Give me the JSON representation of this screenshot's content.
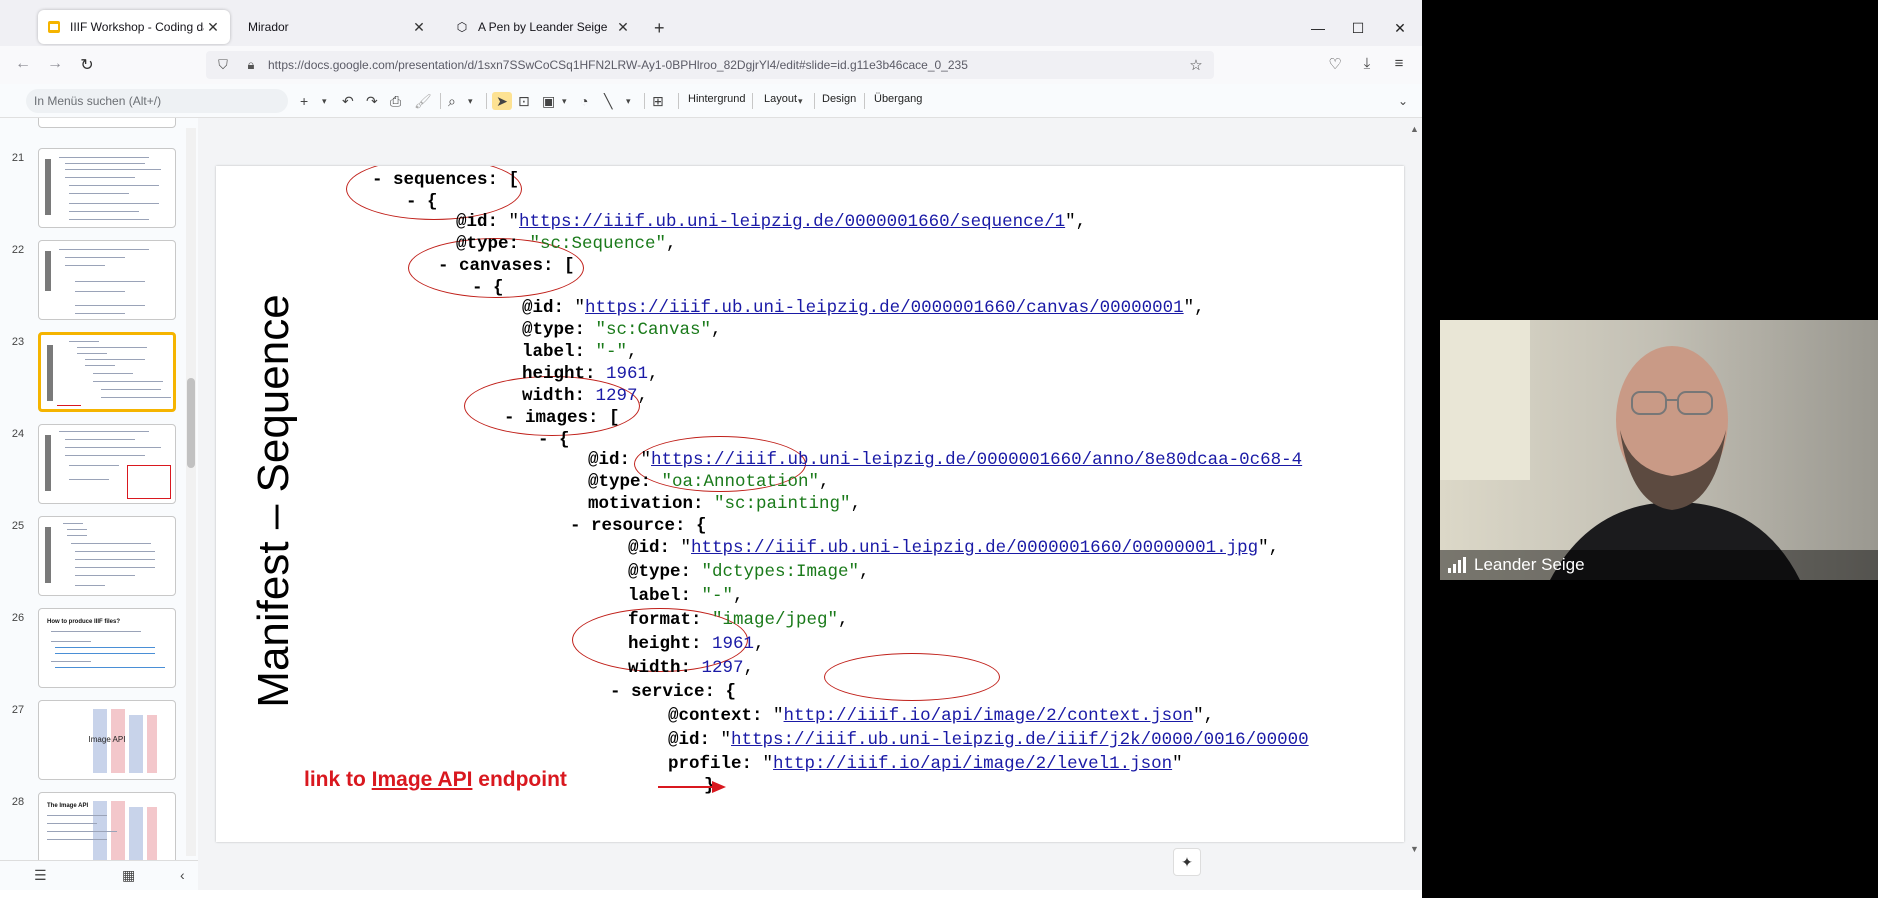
{
  "browser": {
    "tabs": [
      {
        "title": "IIIF Workshop - Coding da Vinci",
        "active": true
      },
      {
        "title": "Mirador",
        "active": false
      },
      {
        "title": "A Pen by Leander Seige",
        "active": false
      }
    ],
    "url": "https://docs.google.com/presentation/d/1sxn7SSwCoCSq1HFN2LRW-Ay1-0BPHlroo_82DgjrYl4/edit#slide=id.g11e3b46cace_0_235"
  },
  "toolbar": {
    "search_placeholder": "In Menüs suchen (Alt+/)",
    "background_label": "Hintergrund",
    "layout_label": "Layout",
    "design_label": "Design",
    "transition_label": "Übergang"
  },
  "filmstrip": {
    "slides": [
      {
        "number": "21"
      },
      {
        "number": "22"
      },
      {
        "number": "23",
        "selected": true
      },
      {
        "number": "24"
      },
      {
        "number": "25"
      },
      {
        "number": "26",
        "caption": "How to produce IIIF files?"
      },
      {
        "number": "27",
        "caption": "Image API"
      },
      {
        "number": "28",
        "caption": "The Image API"
      }
    ]
  },
  "slide": {
    "title": "Manifest – Sequence",
    "annotation_prefix": "link to ",
    "annotation_link": "Image API",
    "annotation_suffix": " endpoint",
    "code": {
      "sequences_key": "- sequences: [",
      "brace1": "- {",
      "seq_id_key": "@id: ",
      "seq_id_val": "https://iiif.ub.uni-leipzig.de/0000001660/sequence/1",
      "seq_type_key": "@type: ",
      "seq_type_val": "\"sc:Sequence\"",
      "canvases_key": "- canvases: [",
      "brace2": "- {",
      "can_id_key": "@id: ",
      "can_id_val": "https://iiif.ub.uni-leipzig.de/0000001660/canvas/00000001",
      "can_type_key": "@type: ",
      "can_type_val": "\"sc:Canvas\"",
      "can_label_key": "label: ",
      "can_label_val": "\"-\"",
      "can_height_key": "height: ",
      "can_height_val": "1961",
      "can_width_key": "width: ",
      "can_width_val": "1297",
      "images_key": "- images: [",
      "brace3": "- {",
      "img_id_key": "@id: ",
      "img_id_val": "https://iiif.ub.uni-leipzig.de/0000001660/anno/8e80dcaa-0c68-4",
      "img_type_key": "@type: ",
      "img_type_val": "\"oa:Annotation\"",
      "motivation_key": "motivation: ",
      "motivation_val": "\"sc:painting\"",
      "resource_key": "- resource: {",
      "res_id_key": "@id: ",
      "res_id_val": "https://iiif.ub.uni-leipzig.de/0000001660/00000001.jpg",
      "res_type_key": "@type: ",
      "res_type_val": "\"dctypes:Image\"",
      "res_label_key": "label: ",
      "res_label_val": "\"-\"",
      "format_key": "format: ",
      "format_val": "\"image/jpeg\"",
      "res_height_key": "height: ",
      "res_height_val": "1961",
      "res_width_key": "width: ",
      "res_width_val": "1297",
      "service_key": "- service: {",
      "context_key": "@context: ",
      "context_val": "http://iiif.io/api/image/2/context.json",
      "svc_id_key": "@id: ",
      "svc_id_val": "https://iiif.ub.uni-leipzig.de/iiif/j2k/0000/0016/00000",
      "profile_key": "profile: ",
      "profile_val": "http://iiif.io/api/image/2/level1.json",
      "closing": "}"
    }
  },
  "video": {
    "participant_name": "Leander Seige"
  },
  "colors": {
    "accent_selected": "#f5b400",
    "ellipse": "#c0201a",
    "annotation": "#d9181f",
    "link": "#1a1aa6",
    "string": "#1a7a1a"
  }
}
